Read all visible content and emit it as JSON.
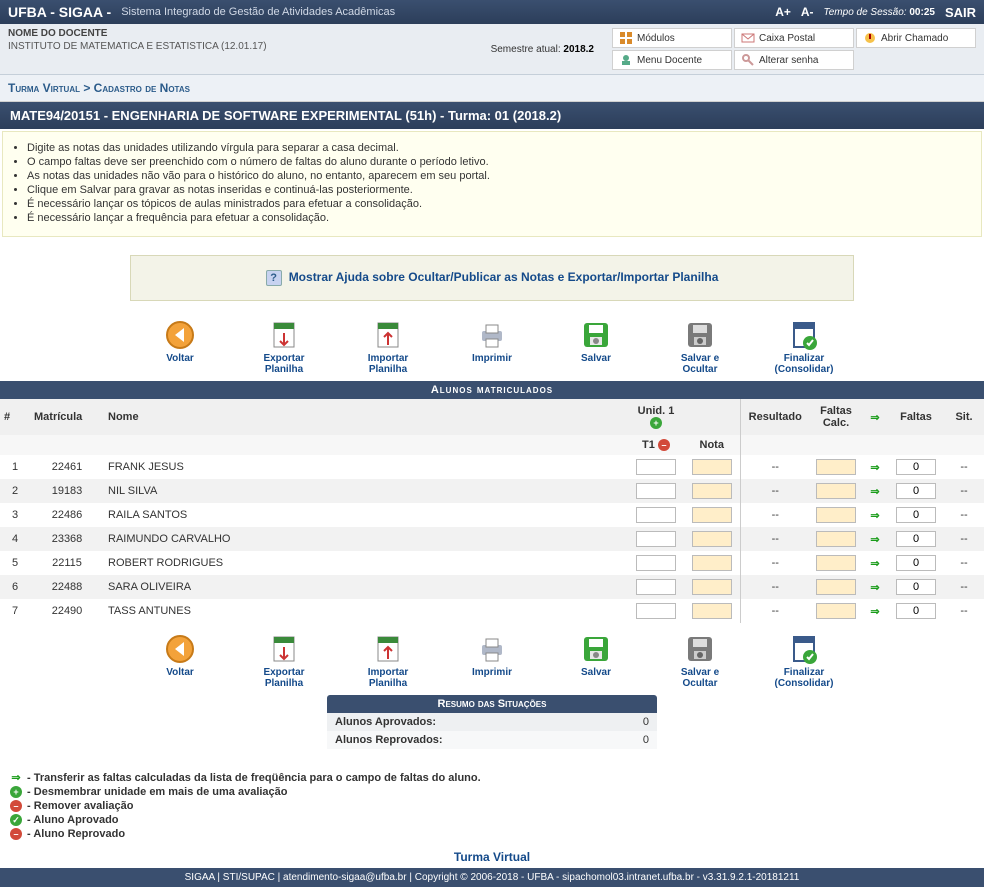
{
  "topbar": {
    "brand": "UFBA - SIGAA -",
    "subtitle": "Sistema Integrado de Gestão de Atividades Acadêmicas",
    "font_up": "A+",
    "font_down": "A-",
    "session_label": "Tempo de Sessão:",
    "session_time": "00:25",
    "exit": "SAIR"
  },
  "userbar": {
    "name": "NOME DO DOCENTE",
    "dept": "INSTITUTO DE MATEMATICA E ESTATISTICA (12.01.17)",
    "sem_label": "Semestre atual:",
    "sem_value": "2018.2",
    "menu": {
      "modulos": "Módulos",
      "caixa": "Caixa Postal",
      "abrir": "Abrir Chamado",
      "docente": "Menu Docente",
      "senha": "Alterar senha"
    }
  },
  "breadcrumb": "Turma Virtual > Cadastro de Notas",
  "title": "MATE94/20151 - ENGENHARIA DE SOFTWARE EXPERIMENTAL (51h) - Turma: 01 (2018.2)",
  "tips": [
    "Digite as notas das unidades utilizando vírgula para separar a casa decimal.",
    "O campo faltas deve ser preenchido com o número de faltas do aluno durante o período letivo.",
    "As notas das unidades não vão para o histórico do aluno, no entanto, aparecem em seu portal.",
    "Clique em Salvar para gravar as notas inseridas e continuá-las posteriormente.",
    "É necessário lançar os tópicos de aulas ministrados para efetuar a consolidação.",
    "É necessário lançar a frequência para efetuar a consolidação."
  ],
  "helpbox": {
    "link": "Mostrar Ajuda sobre Ocultar/Publicar as Notas e Exportar/Importar Planilha"
  },
  "toolbar": {
    "voltar": "Voltar",
    "exportar": "Exportar Planilha",
    "importar": "Importar Planilha",
    "imprimir": "Imprimir",
    "salvar": "Salvar",
    "salvar_ocultar": "Salvar e Ocultar",
    "finalizar": "Finalizar (Consolidar)"
  },
  "section_students": "Alunos matriculados",
  "columns": {
    "idx": "#",
    "matricula": "Matrícula",
    "nome": "Nome",
    "unid1": "Unid. 1",
    "resultado": "Resultado",
    "faltas_calc": "Faltas Calc.",
    "faltas": "Faltas",
    "sit": "Sit.",
    "t1": "T1",
    "nota": "Nota"
  },
  "students": [
    {
      "i": "1",
      "mat": "22461",
      "nome": "FRANK JESUS",
      "res": "--",
      "faltas": "0",
      "sit": "--"
    },
    {
      "i": "2",
      "mat": "19183",
      "nome": "NIL SILVA",
      "res": "--",
      "faltas": "0",
      "sit": "--"
    },
    {
      "i": "3",
      "mat": "22486",
      "nome": "RAILA SANTOS",
      "res": "--",
      "faltas": "0",
      "sit": "--"
    },
    {
      "i": "4",
      "mat": "23368",
      "nome": "RAIMUNDO CARVALHO",
      "res": "--",
      "faltas": "0",
      "sit": "--"
    },
    {
      "i": "5",
      "mat": "22115",
      "nome": "ROBERT RODRIGUES",
      "res": "--",
      "faltas": "0",
      "sit": "--"
    },
    {
      "i": "6",
      "mat": "22488",
      "nome": "SARA OLIVEIRA",
      "res": "--",
      "faltas": "0",
      "sit": "--"
    },
    {
      "i": "7",
      "mat": "22490",
      "nome": "TASS ANTUNES",
      "res": "--",
      "faltas": "0",
      "sit": "--"
    }
  ],
  "summary": {
    "title": "Resumo das Situações",
    "aprov_label": "Alunos Aprovados:",
    "aprov_val": "0",
    "reprov_label": "Alunos Reprovados:",
    "reprov_val": "0"
  },
  "legend": {
    "l1": " - Transferir as faltas calculadas da lista de freqüência para o campo de faltas do aluno.",
    "l2": " - Desmembrar unidade em mais de uma avaliação",
    "l3": " - Remover avaliação",
    "l4": " - Aluno Aprovado",
    "l5": " - Aluno Reprovado"
  },
  "footlink": "Turma Virtual",
  "footer": "SIGAA | STI/SUPAC | atendimento-sigaa@ufba.br | Copyright © 2006-2018 - UFBA - sipachomol03.intranet.ufba.br - v3.31.9.2.1-20181211"
}
